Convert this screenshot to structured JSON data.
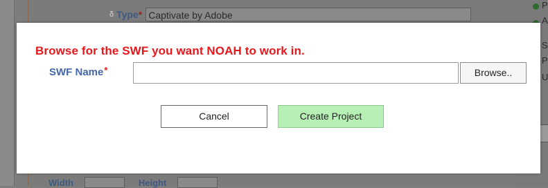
{
  "background": {
    "type_row": {
      "delta_symbol": "δ",
      "label": "Type",
      "required_marker": "*",
      "value": "Captivate by Adobe"
    },
    "right_column_letters": [
      "P",
      "A",
      "S",
      "P",
      "U"
    ],
    "status_dot_color": "#2f6b2f",
    "bottom_row": {
      "width_label": "Width",
      "height_label": "Height"
    }
  },
  "dialog": {
    "prompt": "Browse for the SWF you want NOAH to work in.",
    "prompt_color": "#e8171b",
    "swf_field": {
      "label": "SWF Name",
      "required_marker": "*",
      "value": "",
      "placeholder": ""
    },
    "browse_label": "Browse..",
    "cancel_label": "Cancel",
    "create_label": "Create Project",
    "create_button_color": "#b6f0b4"
  }
}
